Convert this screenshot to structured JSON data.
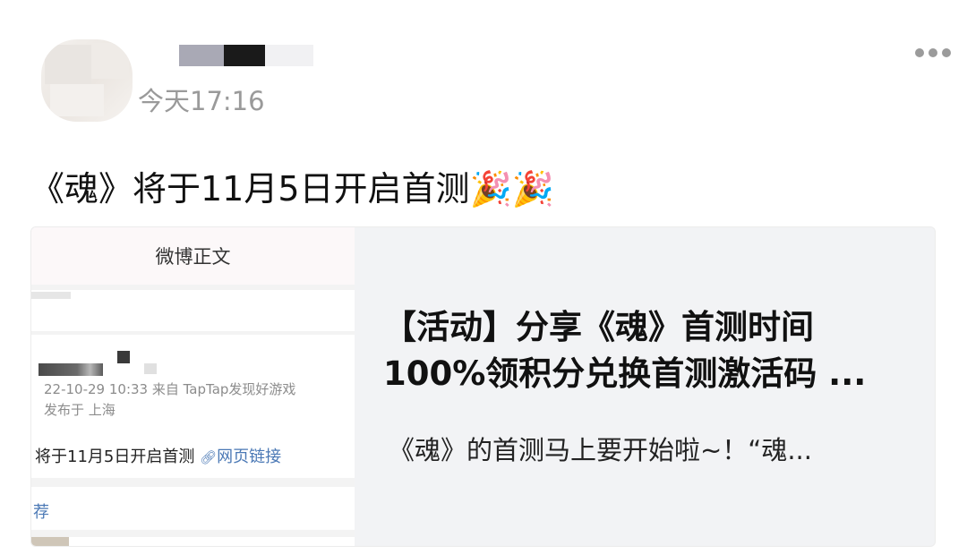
{
  "post": {
    "time": "今天17:16",
    "text": "《魂》将于11月5日开启首测",
    "emoji": "🎉🎉"
  },
  "card": {
    "title_line1": "【活动】分享《魂》首测时间",
    "title_line2": "100%领积分兑换首测激活码 ...",
    "description": "《魂》的首测马上要开始啦~！“魂..."
  },
  "thumbnail": {
    "header": "微博正文",
    "meta_line1": "22-10-29 10:33  来自 TapTap发现好游戏",
    "meta_line2": "发布于 上海",
    "content_text": "将于11月5日开启首测",
    "link_label": "网页链接",
    "tab_text": "荐"
  },
  "icons": {
    "more": "more-dots-icon",
    "link": "link-icon"
  },
  "colors": {
    "time_gray": "#9a9a9a",
    "link_blue": "#4a78b5",
    "card_bg": "#f2f3f5"
  }
}
